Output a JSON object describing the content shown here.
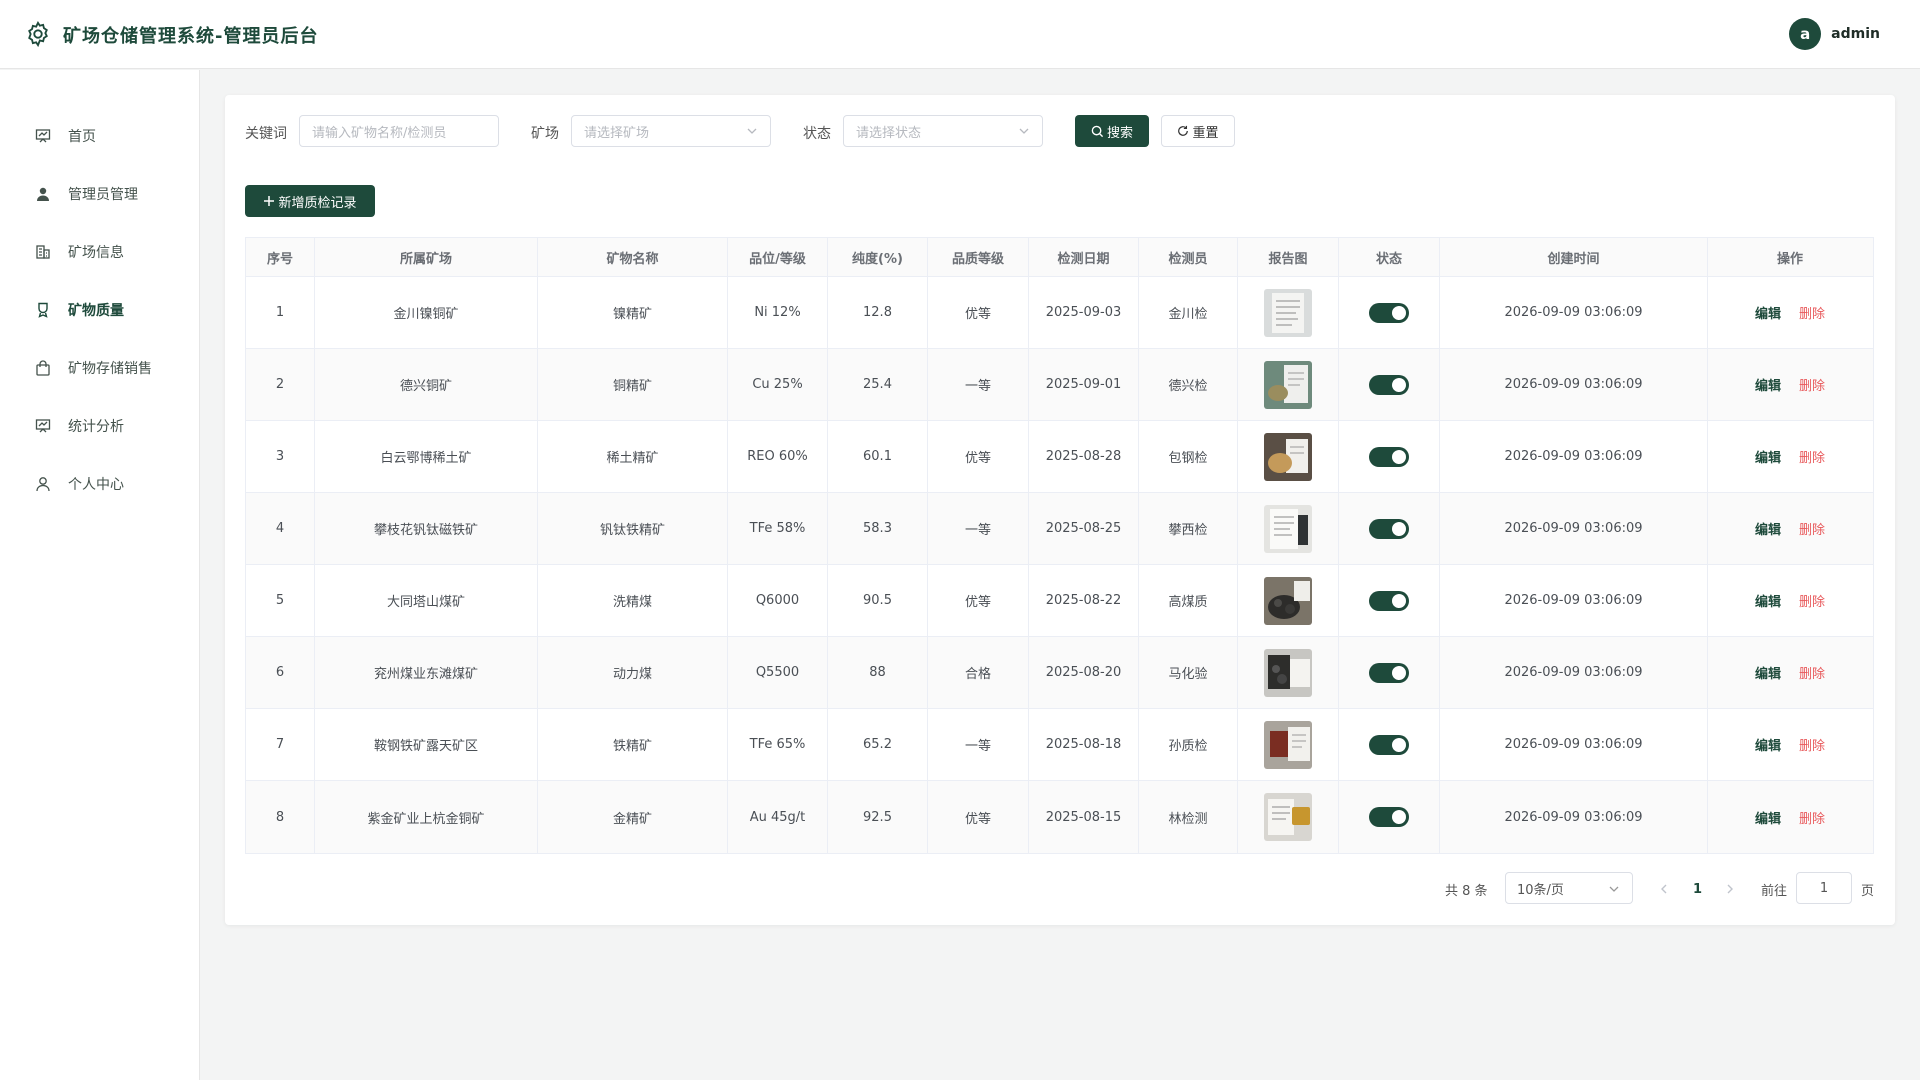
{
  "header": {
    "title": "矿场仓储管理系统-管理员后台",
    "avatar_letter": "a",
    "username": "admin"
  },
  "sidebar": {
    "items": [
      {
        "label": "首页",
        "icon": "dashboard-icon"
      },
      {
        "label": "管理员管理",
        "icon": "user-icon"
      },
      {
        "label": "矿场信息",
        "icon": "building-icon"
      },
      {
        "label": "矿物质量",
        "icon": "badge-icon",
        "active": true
      },
      {
        "label": "矿物存储销售",
        "icon": "bag-icon"
      },
      {
        "label": "统计分析",
        "icon": "chart-icon"
      },
      {
        "label": "个人中心",
        "icon": "person-icon"
      }
    ]
  },
  "filters": {
    "keyword_label": "关键词",
    "keyword_placeholder": "请输入矿物名称/检测员",
    "mine_label": "矿场",
    "mine_placeholder": "请选择矿场",
    "status_label": "状态",
    "status_placeholder": "请选择状态",
    "search_label": "搜索",
    "reset_label": "重置"
  },
  "add_button_label": "新增质检记录",
  "table": {
    "headers": [
      "序号",
      "所属矿场",
      "矿物名称",
      "品位/等级",
      "纯度(%)",
      "品质等级",
      "检测日期",
      "检测员",
      "报告图",
      "状态",
      "创建时间",
      "操作"
    ],
    "edit_label": "编辑",
    "delete_label": "删除",
    "rows": [
      {
        "no": "1",
        "mine": "金川镍铜矿",
        "mineral": "镍精矿",
        "grade": "Ni 12%",
        "purity": "12.8",
        "quality": "优等",
        "date": "2025-09-03",
        "inspector": "金川检",
        "status_on": true,
        "created": "2026-09-09 03:06:09"
      },
      {
        "no": "2",
        "mine": "德兴铜矿",
        "mineral": "铜精矿",
        "grade": "Cu 25%",
        "purity": "25.4",
        "quality": "一等",
        "date": "2025-09-01",
        "inspector": "德兴检",
        "status_on": true,
        "created": "2026-09-09 03:06:09"
      },
      {
        "no": "3",
        "mine": "白云鄂博稀土矿",
        "mineral": "稀土精矿",
        "grade": "REO 60%",
        "purity": "60.1",
        "quality": "优等",
        "date": "2025-08-28",
        "inspector": "包钢检",
        "status_on": true,
        "created": "2026-09-09 03:06:09"
      },
      {
        "no": "4",
        "mine": "攀枝花钒钛磁铁矿",
        "mineral": "钒钛铁精矿",
        "grade": "TFe 58%",
        "purity": "58.3",
        "quality": "一等",
        "date": "2025-08-25",
        "inspector": "攀西检",
        "status_on": true,
        "created": "2026-09-09 03:06:09"
      },
      {
        "no": "5",
        "mine": "大同塔山煤矿",
        "mineral": "洗精煤",
        "grade": "Q6000",
        "purity": "90.5",
        "quality": "优等",
        "date": "2025-08-22",
        "inspector": "高煤质",
        "status_on": true,
        "created": "2026-09-09 03:06:09"
      },
      {
        "no": "6",
        "mine": "兖州煤业东滩煤矿",
        "mineral": "动力煤",
        "grade": "Q5500",
        "purity": "88",
        "quality": "合格",
        "date": "2025-08-20",
        "inspector": "马化验",
        "status_on": true,
        "created": "2026-09-09 03:06:09"
      },
      {
        "no": "7",
        "mine": "鞍钢铁矿露天矿区",
        "mineral": "铁精矿",
        "grade": "TFe 65%",
        "purity": "65.2",
        "quality": "一等",
        "date": "2025-08-18",
        "inspector": "孙质检",
        "status_on": true,
        "created": "2026-09-09 03:06:09"
      },
      {
        "no": "8",
        "mine": "紫金矿业上杭金铜矿",
        "mineral": "金精矿",
        "grade": "Au 45g/t",
        "purity": "92.5",
        "quality": "优等",
        "date": "2025-08-15",
        "inspector": "林检测",
        "status_on": true,
        "created": "2026-09-09 03:06:09"
      }
    ]
  },
  "pagination": {
    "total_text": "共 8 条",
    "page_size": "10条/页",
    "current_page": "1",
    "goto_label": "前往",
    "goto_value": "1",
    "page_suffix": "页"
  },
  "colors": {
    "primary": "#1e4a3b",
    "danger": "#e8585a",
    "background": "#f3f4f4"
  }
}
